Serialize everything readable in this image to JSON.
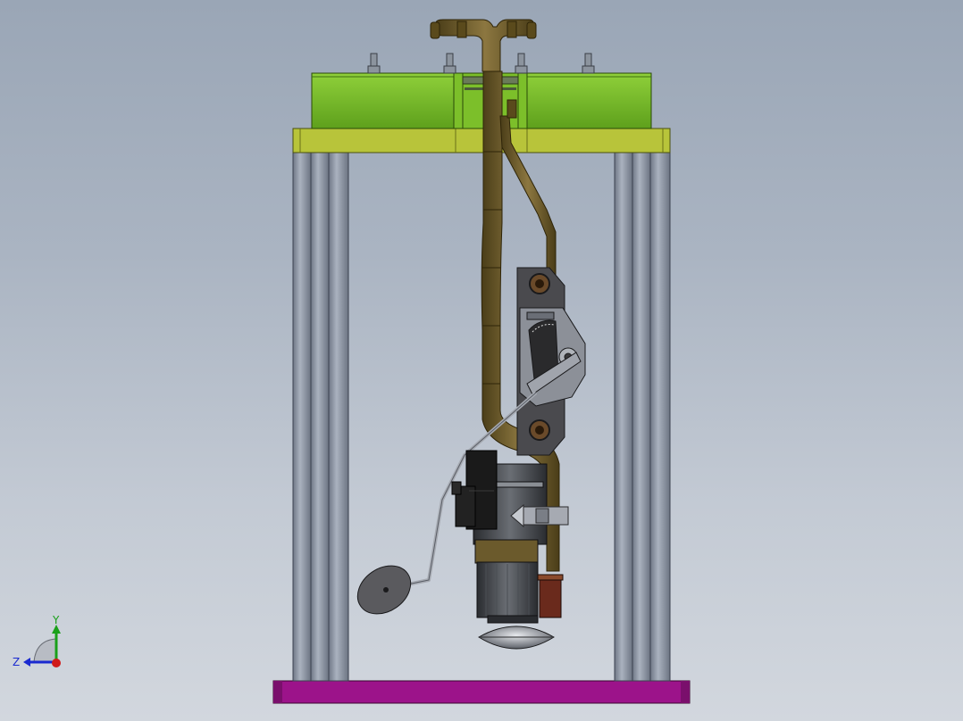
{
  "viewport": {
    "background_top": "#9aa6b6",
    "background_bottom": "#d2d7de"
  },
  "model": {
    "frame_color": "#8f98a6",
    "top_plate_color": "#b8c43a",
    "tank_color": "#7cbf2a",
    "base_plate_color": "#9c138a",
    "pipe_color": "#6b5a2c",
    "bracket_color": "#4a4a4e",
    "motor_color": "#3a3c40",
    "float_color": "#5a5a5e",
    "connector_color": "#1a1a1a"
  },
  "triad": {
    "y_label": "Y",
    "z_label": "Z",
    "y_color": "#1aa01a",
    "z_color": "#1a2ad0",
    "x_color": "#d01a1a"
  }
}
